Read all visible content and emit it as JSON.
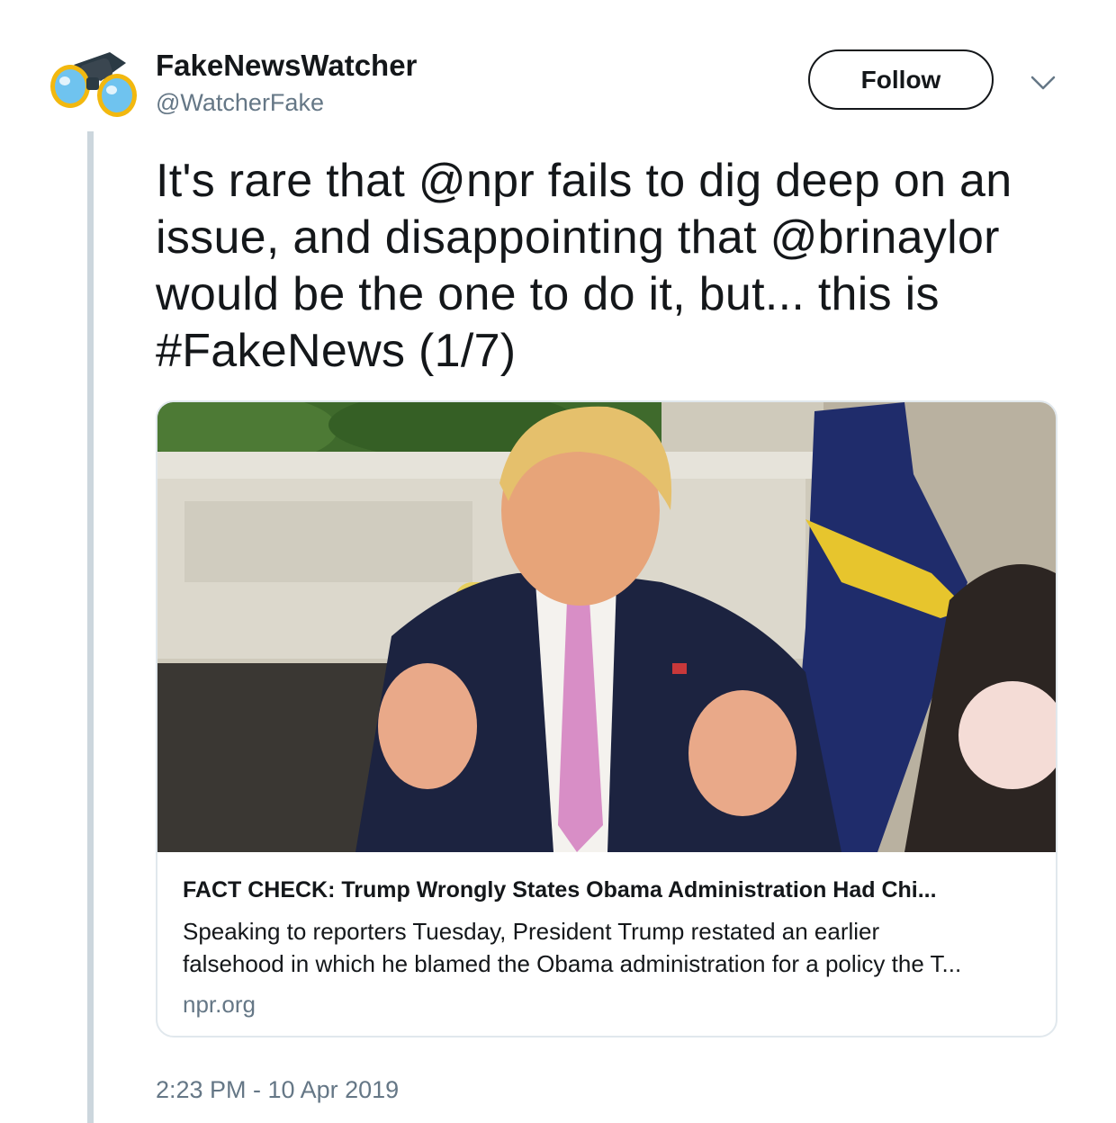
{
  "tweet": {
    "display_name": "FakeNewsWatcher",
    "handle": "@WatcherFake",
    "follow_label": "Follow",
    "menu_icon": "chevron-down-icon",
    "avatar_icon": "binoculars-icon",
    "text_lines": [
      "It's rare that @npr fails to dig deep on an",
      "issue, and disappointing that @brinaylor",
      "would be the one to do it, but... this is",
      "#FakeNews (1/7)"
    ],
    "timestamp": "2:23 PM - 10 Apr 2019"
  },
  "card": {
    "title": "FACT CHECK: Trump Wrongly States Obama Administration Had Chi...",
    "description_lines": [
      "Speaking to reporters Tuesday, President Trump restated an earlier",
      "falsehood in which he blamed the Obama administration for a policy the T..."
    ],
    "domain": "npr.org"
  },
  "colors": {
    "text_primary": "#14171a",
    "text_secondary": "#657786",
    "border": "#e1e8ed",
    "thread_line": "#ccd6dd"
  }
}
